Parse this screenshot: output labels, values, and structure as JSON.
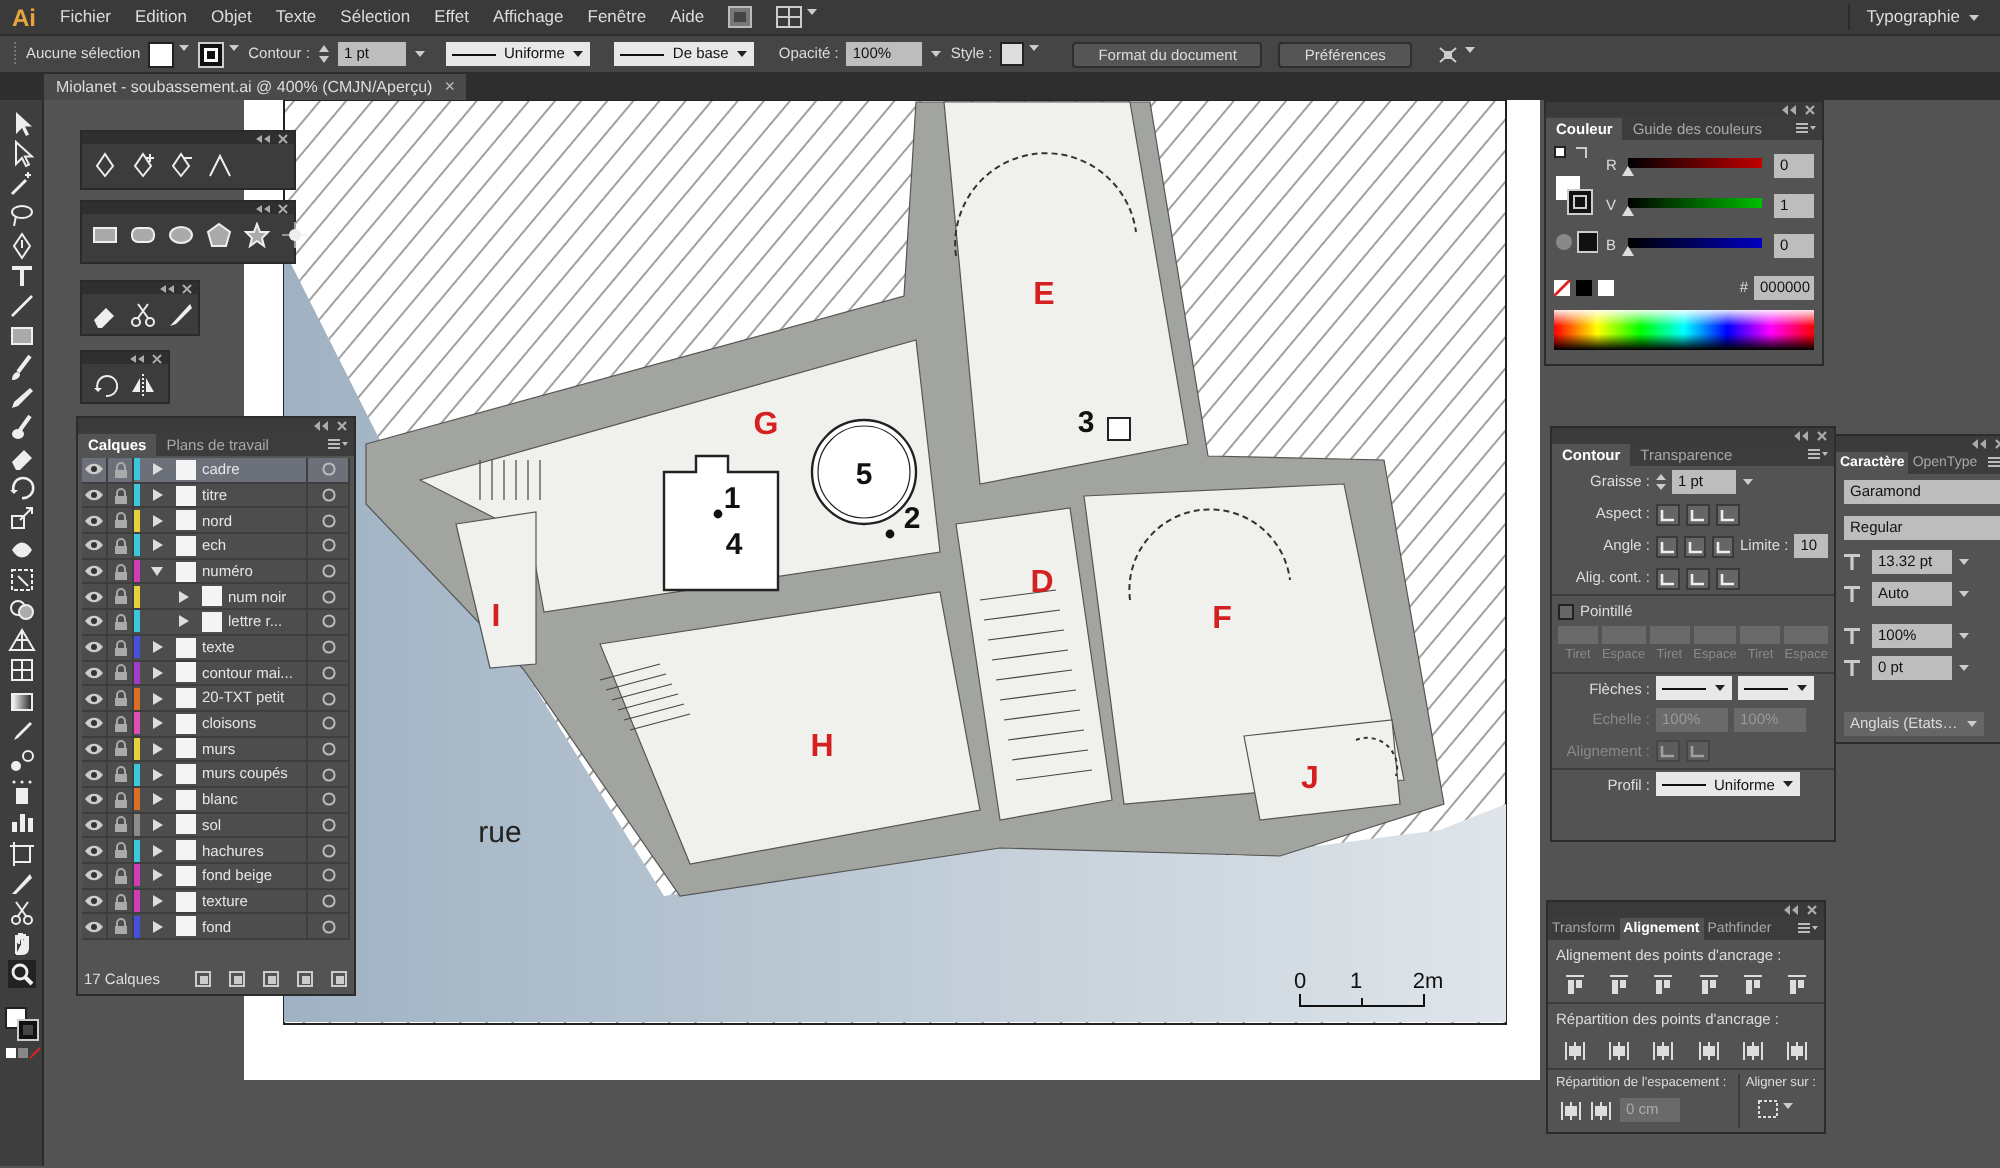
{
  "menu_bar": {
    "logo": "Ai",
    "items": [
      "Fichier",
      "Edition",
      "Objet",
      "Texte",
      "Sélection",
      "Effet",
      "Affichage",
      "Fenêtre",
      "Aide"
    ],
    "workspace": "Typographie"
  },
  "control_bar": {
    "selection": "Aucune sélection",
    "stroke_label": "Contour :",
    "stroke_weight": "1 pt",
    "profile": "Uniforme",
    "brush": "De base",
    "opacity_label": "Opacité :",
    "opacity": "100%",
    "style_label": "Style :",
    "buttons": [
      "Format du document",
      "Préférences"
    ]
  },
  "document_tab": {
    "title": "Miolanet - soubassement.ai @ 400% (CMJN/Aperçu)",
    "close": "×"
  },
  "drawing": {
    "room_labels": [
      "E",
      "G",
      "D",
      "F",
      "H",
      "I",
      "J"
    ],
    "numbers": [
      "1",
      "4",
      "5",
      "2",
      "3"
    ],
    "street": "rue",
    "scale_labels": [
      "0",
      "1",
      "2m"
    ]
  },
  "layers_panel": {
    "tabs": [
      {
        "label": "Calques",
        "selected": true
      },
      {
        "label": "Plans de travail",
        "selected": false
      }
    ],
    "layers": [
      {
        "name": "cadre",
        "color": "#3cc8dc",
        "selected": true,
        "expanded": false
      },
      {
        "name": "titre",
        "color": "#3cc8dc",
        "selected": false,
        "expanded": false
      },
      {
        "name": "nord",
        "color": "#e6d23c",
        "selected": false,
        "expanded": false
      },
      {
        "name": "ech",
        "color": "#3cc8dc",
        "selected": false,
        "expanded": false
      },
      {
        "name": "numéro",
        "color": "#d23cb4",
        "selected": false,
        "expanded": true,
        "children": [
          {
            "name": "num noir",
            "color": "#e6d23c",
            "selected": false,
            "expanded": false
          },
          {
            "name": "lettre r...",
            "color": "#3cc8dc",
            "selected": false,
            "expanded": false
          }
        ]
      },
      {
        "name": "texte",
        "color": "#4650dc",
        "selected": false,
        "expanded": false
      },
      {
        "name": "contour mai...",
        "color": "#a03cc8",
        "selected": false,
        "expanded": false
      },
      {
        "name": "20-TXT petit",
        "color": "#dc6e28",
        "selected": false,
        "expanded": false
      },
      {
        "name": "cloisons",
        "color": "#dc50b4",
        "selected": false,
        "expanded": false
      },
      {
        "name": "murs",
        "color": "#e6d23c",
        "selected": false,
        "expanded": false
      },
      {
        "name": "murs coupés",
        "color": "#3cc8dc",
        "selected": false,
        "expanded": false
      },
      {
        "name": "blanc",
        "color": "#dc6e28",
        "selected": false,
        "expanded": false
      },
      {
        "name": "sol",
        "color": "#8c8c8c",
        "selected": false,
        "expanded": false
      },
      {
        "name": "hachures",
        "color": "#3cc8dc",
        "selected": false,
        "expanded": false
      },
      {
        "name": "fond beige",
        "color": "#d23cb4",
        "selected": false,
        "expanded": false
      },
      {
        "name": "texture",
        "color": "#d23cb4",
        "selected": false,
        "expanded": false
      },
      {
        "name": "fond",
        "color": "#4650dc",
        "selected": false,
        "expanded": false
      }
    ],
    "count": "17 Calques"
  },
  "color_panel": {
    "tabs": [
      {
        "label": "Couleur",
        "selected": true
      },
      {
        "label": "Guide des couleurs",
        "selected": false
      }
    ],
    "channels": [
      {
        "name": "R",
        "value": "0",
        "level": 0
      },
      {
        "name": "V",
        "value": "1",
        "level": 0.004
      },
      {
        "name": "B",
        "value": "0",
        "level": 0
      }
    ],
    "hex_label": "#",
    "hex": "000000"
  },
  "stroke_panel": {
    "tabs": [
      {
        "label": "Contour",
        "selected": true
      },
      {
        "label": "Transparence",
        "selected": false
      }
    ],
    "weight_label": "Graisse :",
    "weight": "1 pt",
    "cap_label": "Aspect :",
    "corner_label": "Angle :",
    "limit_label": "Limite :",
    "limit": "10",
    "align_label": "Alig. cont. :",
    "dashed": {
      "label": "Pointillé",
      "checked": false
    },
    "dash_fields": {
      "labels": [
        "Tiret",
        "Espace",
        "Tiret",
        "Espace",
        "Tiret",
        "Espace"
      ],
      "disabled": true
    },
    "arrows_label": "Flèches :",
    "scale": {
      "label": "Echelle :",
      "values": [
        "100%",
        "100%"
      ],
      "disabled": true
    },
    "alignment": {
      "label": "Alignement :",
      "disabled": true
    },
    "profile_label": "Profil :",
    "profile": "Uniforme"
  },
  "character_panel": {
    "tabs": [
      {
        "label": "Caractère",
        "selected": true
      },
      {
        "label": "OpenType",
        "selected": false
      }
    ],
    "font": "Garamond",
    "style": "Regular",
    "size": "13.32 pt",
    "kerning": "Auto",
    "scale": "100%",
    "baseline": "0 pt",
    "language": "Anglais (Etats…"
  },
  "align_panel": {
    "tabs": [
      {
        "label": "Transform",
        "selected": false
      },
      {
        "label": "Alignement",
        "selected": true
      },
      {
        "label": "Pathfinder",
        "selected": false
      }
    ],
    "sections": [
      "Alignement des points d'ancrage :",
      "Répartition des points d'ancrage :",
      "Répartition de l'espacement :"
    ],
    "align_to": "Aligner sur :",
    "spacing": "0 cm"
  }
}
